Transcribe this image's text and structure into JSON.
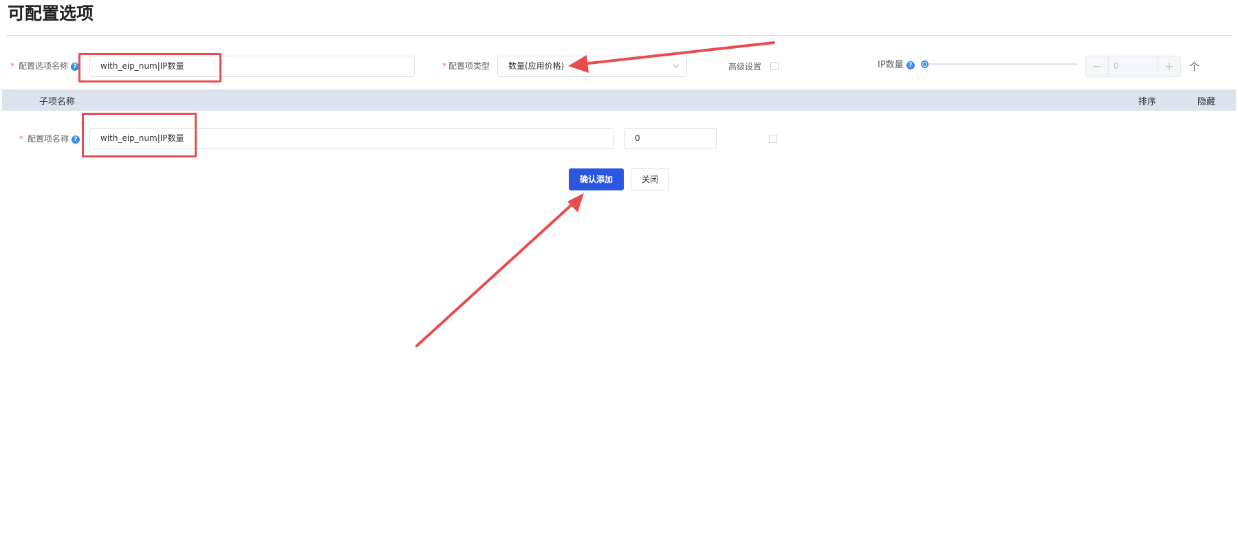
{
  "page": {
    "title": "可配置选项"
  },
  "form": {
    "option_name_label": "配置选项名称",
    "option_name_value": "with_eip_num|IP数量",
    "type_label": "配置项类型",
    "type_value": "数量(应用价格)",
    "advanced_label": "高级设置",
    "advanced_checked": false,
    "slider_label": "IP数量",
    "slider_value": 0,
    "stepper_value": "0",
    "stepper_minus": "−",
    "stepper_plus": "+",
    "unit": "个",
    "required_mark": "*",
    "help_mark": "?"
  },
  "table": {
    "col_subitem": "子项名称",
    "col_sort": "排序",
    "col_hide": "隐藏"
  },
  "row": {
    "label": "配置项名称",
    "name_value": "with_eip_num|IP数量",
    "sort_value": "0",
    "hidden_checked": false
  },
  "actions": {
    "confirm_label": "确认添加",
    "close_label": "关闭"
  },
  "colors": {
    "primary": "#2a56e0",
    "annotation": "#e84c4c",
    "table_header": "#dce3ee",
    "help_icon": "#3b8cf0"
  }
}
